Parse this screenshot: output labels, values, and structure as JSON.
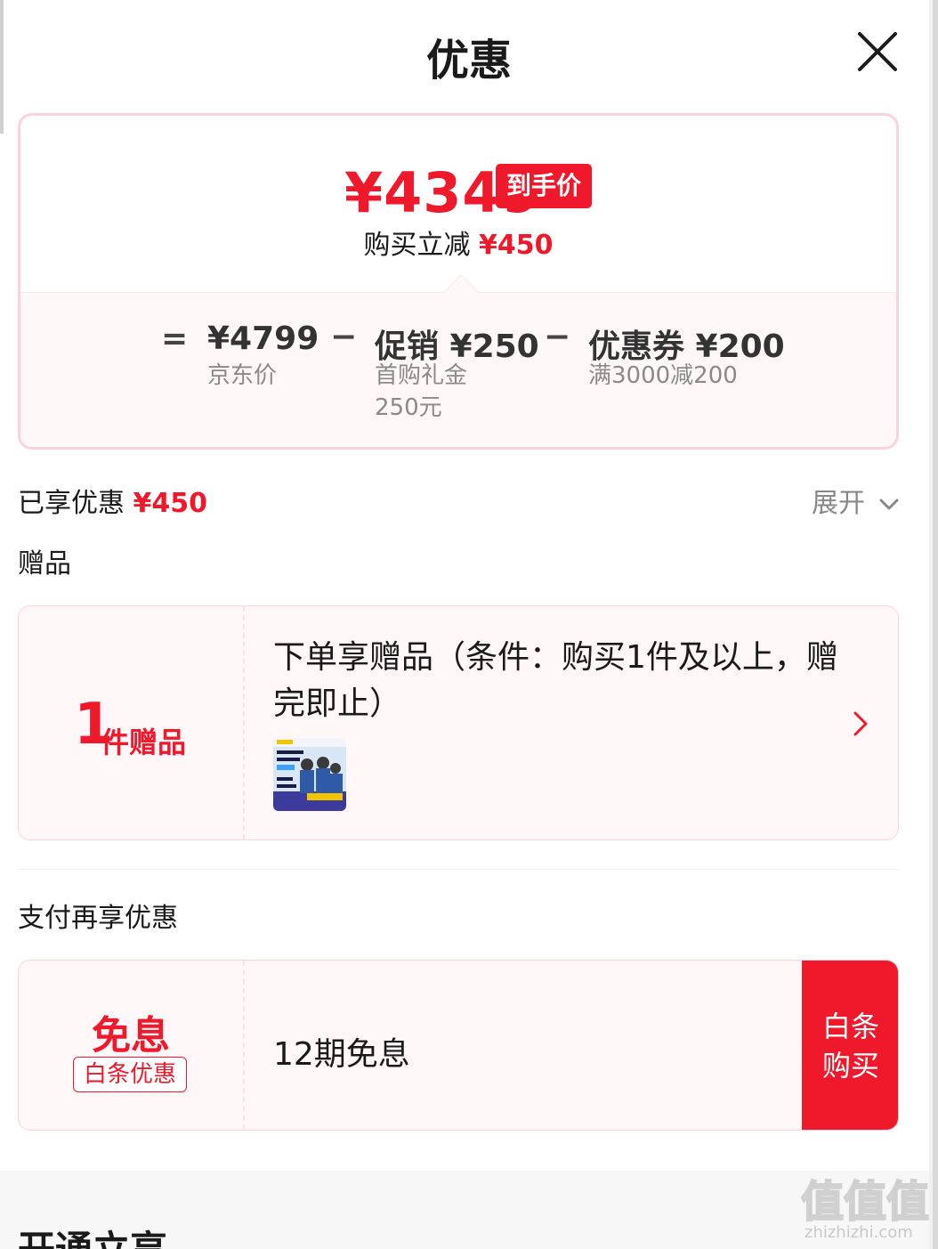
{
  "header": {
    "title": "优惠",
    "close_icon": "close-icon"
  },
  "price_card": {
    "final_price": "¥4349",
    "final_badge": "到手价",
    "save_label": "购买立减",
    "save_amount": "¥450",
    "equals": "=",
    "minus": "−",
    "jd": {
      "value": "¥4799",
      "sub": "京东价"
    },
    "promo": {
      "value": "促销 ¥250",
      "sub_line1": "首购礼金",
      "sub_line2": "250元"
    },
    "coupon": {
      "value": "优惠券 ¥200",
      "sub": "满3000减200"
    }
  },
  "enjoyed": {
    "label": "已享优惠",
    "amount": "¥450",
    "expand_label": "展开"
  },
  "gifts": {
    "section_title": "赠品",
    "count": "1",
    "unit": "件赠品",
    "description": "下单享赠品（条件：购买1件及以上，赠完即止）",
    "thumb_lines": [
      "一站式解决",
      "手机问题",
      "轻松焕新 在线看"
    ]
  },
  "pay": {
    "section_title": "支付再享优惠",
    "big_label": "免息",
    "tag": "白条优惠",
    "description": "12期免息",
    "button_line1": "白条",
    "button_line2": "购买"
  },
  "next_section": {
    "title": "开通立享"
  },
  "watermark": {
    "text": "zhizhizhi.com",
    "glyphs": "值值值"
  },
  "colors": {
    "accent": "#f0192c",
    "card_bg": "#fff7f8",
    "card_border": "#fad4da"
  }
}
